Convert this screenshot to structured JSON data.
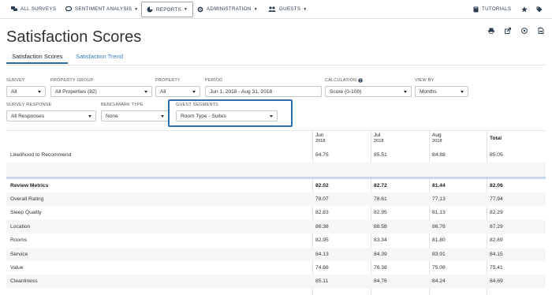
{
  "nav": {
    "all_surveys": "ALL SURVEYS",
    "sentiment": "SENTIMENT ANALYSIS",
    "reports": "REPORTS",
    "administration": "ADMINISTRATION",
    "guests": "GUESTS",
    "tutorials": "TUTORIALS"
  },
  "page": {
    "title": "Satisfaction Scores",
    "tabs": [
      "Satisfaction Scores",
      "Satisfaction Trend"
    ]
  },
  "filters": {
    "survey": {
      "label": "SURVEY",
      "value": "All"
    },
    "property_group": {
      "label": "PROPERTY GROUP",
      "value": "All Properties (82)"
    },
    "property": {
      "label": "PROPERTY",
      "value": "All"
    },
    "period": {
      "label": "PERIOD",
      "value": "Jun 1, 2018 - Aug 31, 2018"
    },
    "calculation": {
      "label": "CALCULATION",
      "value": "Score (0-100)"
    },
    "view_by": {
      "label": "VIEW BY",
      "value": "Months"
    },
    "survey_response": {
      "label": "SURVEY RESPONSE",
      "value": "All Responses"
    },
    "benchmark_type": {
      "label": "BENCHMARK TYPE",
      "value": "None"
    },
    "guest_segments": {
      "label": "GUEST SEGMENTS",
      "value": "Room Type - Suites"
    }
  },
  "table": {
    "columns": [
      {
        "month": "Jun",
        "year": "2018"
      },
      {
        "month": "Jul",
        "year": "2018"
      },
      {
        "month": "Aug",
        "year": "2018"
      }
    ],
    "total_label": "Total",
    "ltr": {
      "label": "Likelihood to Recommend",
      "values": [
        "84.75",
        "85.51",
        "84.88",
        "85.05"
      ]
    },
    "review_metrics": {
      "label": "Review Metrics",
      "values": [
        "82.02",
        "82.72",
        "81.44",
        "82.06"
      ]
    },
    "rows": [
      {
        "label": "Overall Rating",
        "values": [
          "78.07",
          "78.61",
          "77.13",
          "77.94"
        ]
      },
      {
        "label": "Sleep Quality",
        "values": [
          "82.83",
          "82.95",
          "81.13",
          "82.29"
        ]
      },
      {
        "label": "Location",
        "values": [
          "86.38",
          "88.58",
          "86.78",
          "87.29"
        ]
      },
      {
        "label": "Rooms",
        "values": [
          "82.95",
          "83.34",
          "81.80",
          "82.69"
        ]
      },
      {
        "label": "Service",
        "values": [
          "84.13",
          "84.39",
          "83.91",
          "84.15"
        ]
      },
      {
        "label": "Value",
        "values": [
          "74.66",
          "76.38",
          "75.08",
          "75.41"
        ]
      },
      {
        "label": "Cleanliness",
        "values": [
          "85.11",
          "84.76",
          "84.24",
          "84.69"
        ]
      }
    ]
  }
}
